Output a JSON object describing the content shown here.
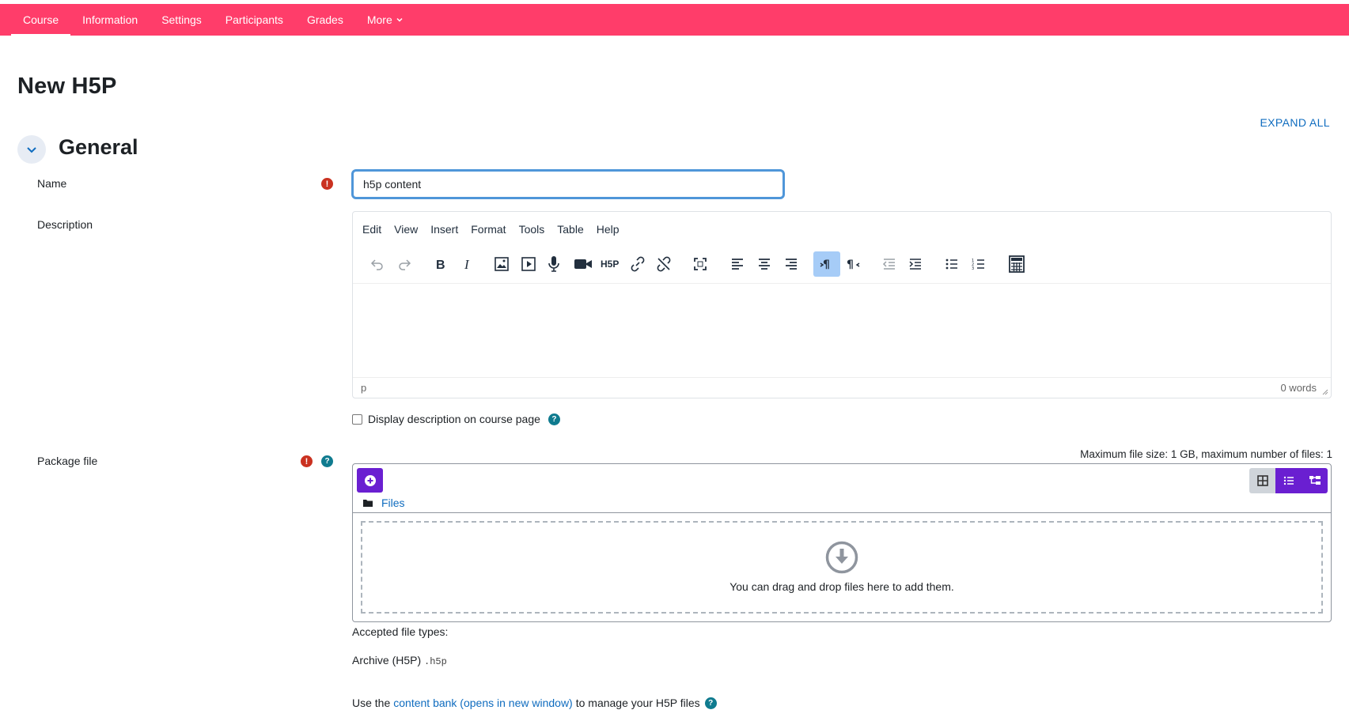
{
  "nav": {
    "items": [
      {
        "label": "Course",
        "active": true
      },
      {
        "label": "Information",
        "active": false
      },
      {
        "label": "Settings",
        "active": false
      },
      {
        "label": "Participants",
        "active": false
      },
      {
        "label": "Grades",
        "active": false
      },
      {
        "label": "More",
        "active": false
      }
    ]
  },
  "page": {
    "title": "New H5P",
    "expand_all": "EXPAND ALL"
  },
  "general": {
    "title": "General",
    "name_label": "Name",
    "name_value": "h5p content",
    "description_label": "Description",
    "editor": {
      "menu": [
        "Edit",
        "View",
        "Insert",
        "Format",
        "Tools",
        "Table",
        "Help"
      ],
      "status_path": "p",
      "word_count": "0 words"
    },
    "display_description_label": "Display description on course page",
    "package_label": "Package file",
    "max_size": "Maximum file size: 1 GB, maximum number of files: 1",
    "files_crumb": "Files",
    "dropzone_text": "You can drag and drop files here to add them.",
    "accepted_label": "Accepted file types:",
    "archive_label": "Archive (H5P)",
    "archive_ext": ".h5p",
    "bank_prefix": "Use the",
    "bank_link": "content bank (opens in new window)",
    "bank_suffix": "to manage your H5P files"
  },
  "colors": {
    "topbar": "#ff3d6a",
    "link": "#0f6cbf",
    "required": "#ca3120",
    "help": "#0f7b8f",
    "filepicker_accent": "#6a1fd1"
  }
}
